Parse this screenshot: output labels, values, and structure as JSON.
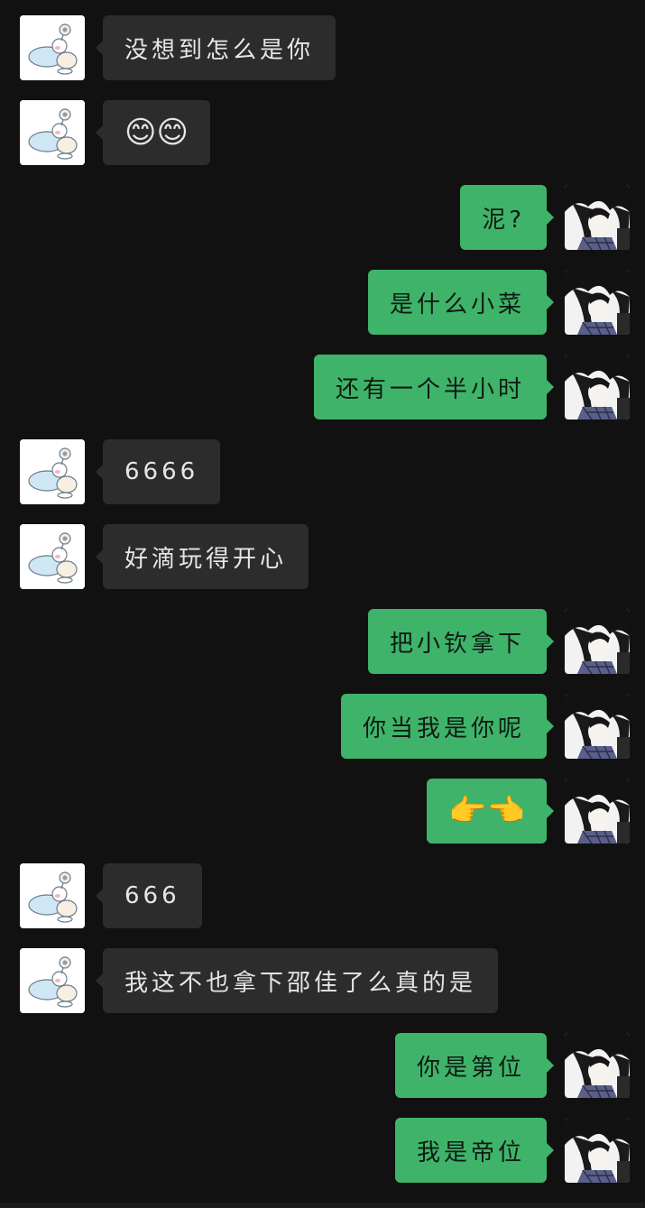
{
  "messages": [
    {
      "side": "in",
      "text": "没想到怎么是你"
    },
    {
      "side": "in",
      "text": "😊😊"
    },
    {
      "side": "out",
      "text": "泥?"
    },
    {
      "side": "out",
      "text": "是什么小菜"
    },
    {
      "side": "out",
      "text": "还有一个半小时"
    },
    {
      "side": "in",
      "text": "6666"
    },
    {
      "side": "in",
      "text": "好滴玩得开心"
    },
    {
      "side": "out",
      "text": "把小钦拿下"
    },
    {
      "side": "out",
      "text": "你当我是你呢"
    },
    {
      "side": "out",
      "text": "👉👈"
    },
    {
      "side": "in",
      "text": "666"
    },
    {
      "side": "in",
      "text": "我这不也拿下邵佳了么真的是"
    },
    {
      "side": "out",
      "text": "你是第位"
    },
    {
      "side": "out",
      "text": "我是帝位"
    }
  ],
  "colors": {
    "background": "#111111",
    "incoming_bubble": "#2c2c2c",
    "outgoing_bubble": "#3fb36a"
  },
  "icons": {
    "incoming_avatar": "cartoon-sleeping-avatar-icon",
    "outgoing_avatar": "anime-boy-avatar-icon"
  }
}
